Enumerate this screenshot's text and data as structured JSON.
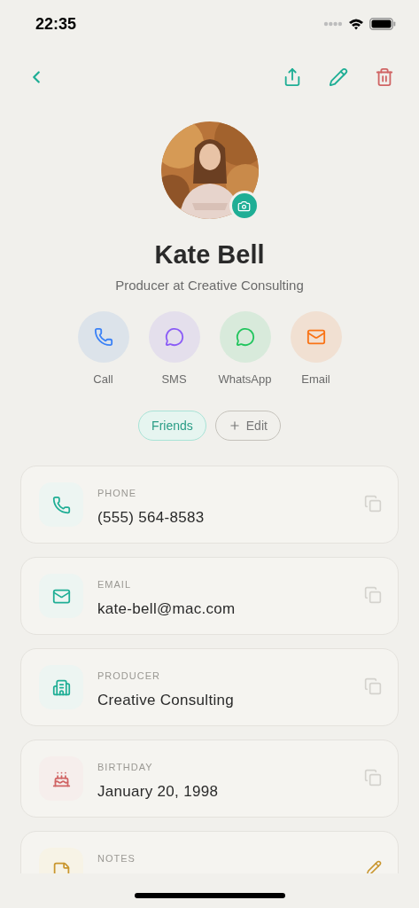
{
  "status_bar": {
    "time": "22:35"
  },
  "contact": {
    "name": "Kate Bell",
    "subtitle": "Producer at Creative Consulting"
  },
  "actions": [
    {
      "kind": "call",
      "label": "Call"
    },
    {
      "kind": "sms",
      "label": "SMS"
    },
    {
      "kind": "whatsapp",
      "label": "WhatsApp"
    },
    {
      "kind": "email",
      "label": "Email"
    }
  ],
  "tags": [
    {
      "label": "Friends"
    }
  ],
  "add_tag_button": {
    "label": "Edit"
  },
  "fields": [
    {
      "kind": "phone",
      "label": "PHONE",
      "value": "(555) 564-8583",
      "copyable": true
    },
    {
      "kind": "email",
      "label": "EMAIL",
      "value": "kate-bell@mac.com",
      "copyable": true
    },
    {
      "kind": "company",
      "label": "PRODUCER",
      "value": "Creative Consulting",
      "copyable": true
    },
    {
      "kind": "birthday",
      "label": "BIRTHDAY",
      "value": "January 20, 1998",
      "copyable": true
    },
    {
      "kind": "notes",
      "label": "NOTES",
      "copyable": false
    }
  ]
}
